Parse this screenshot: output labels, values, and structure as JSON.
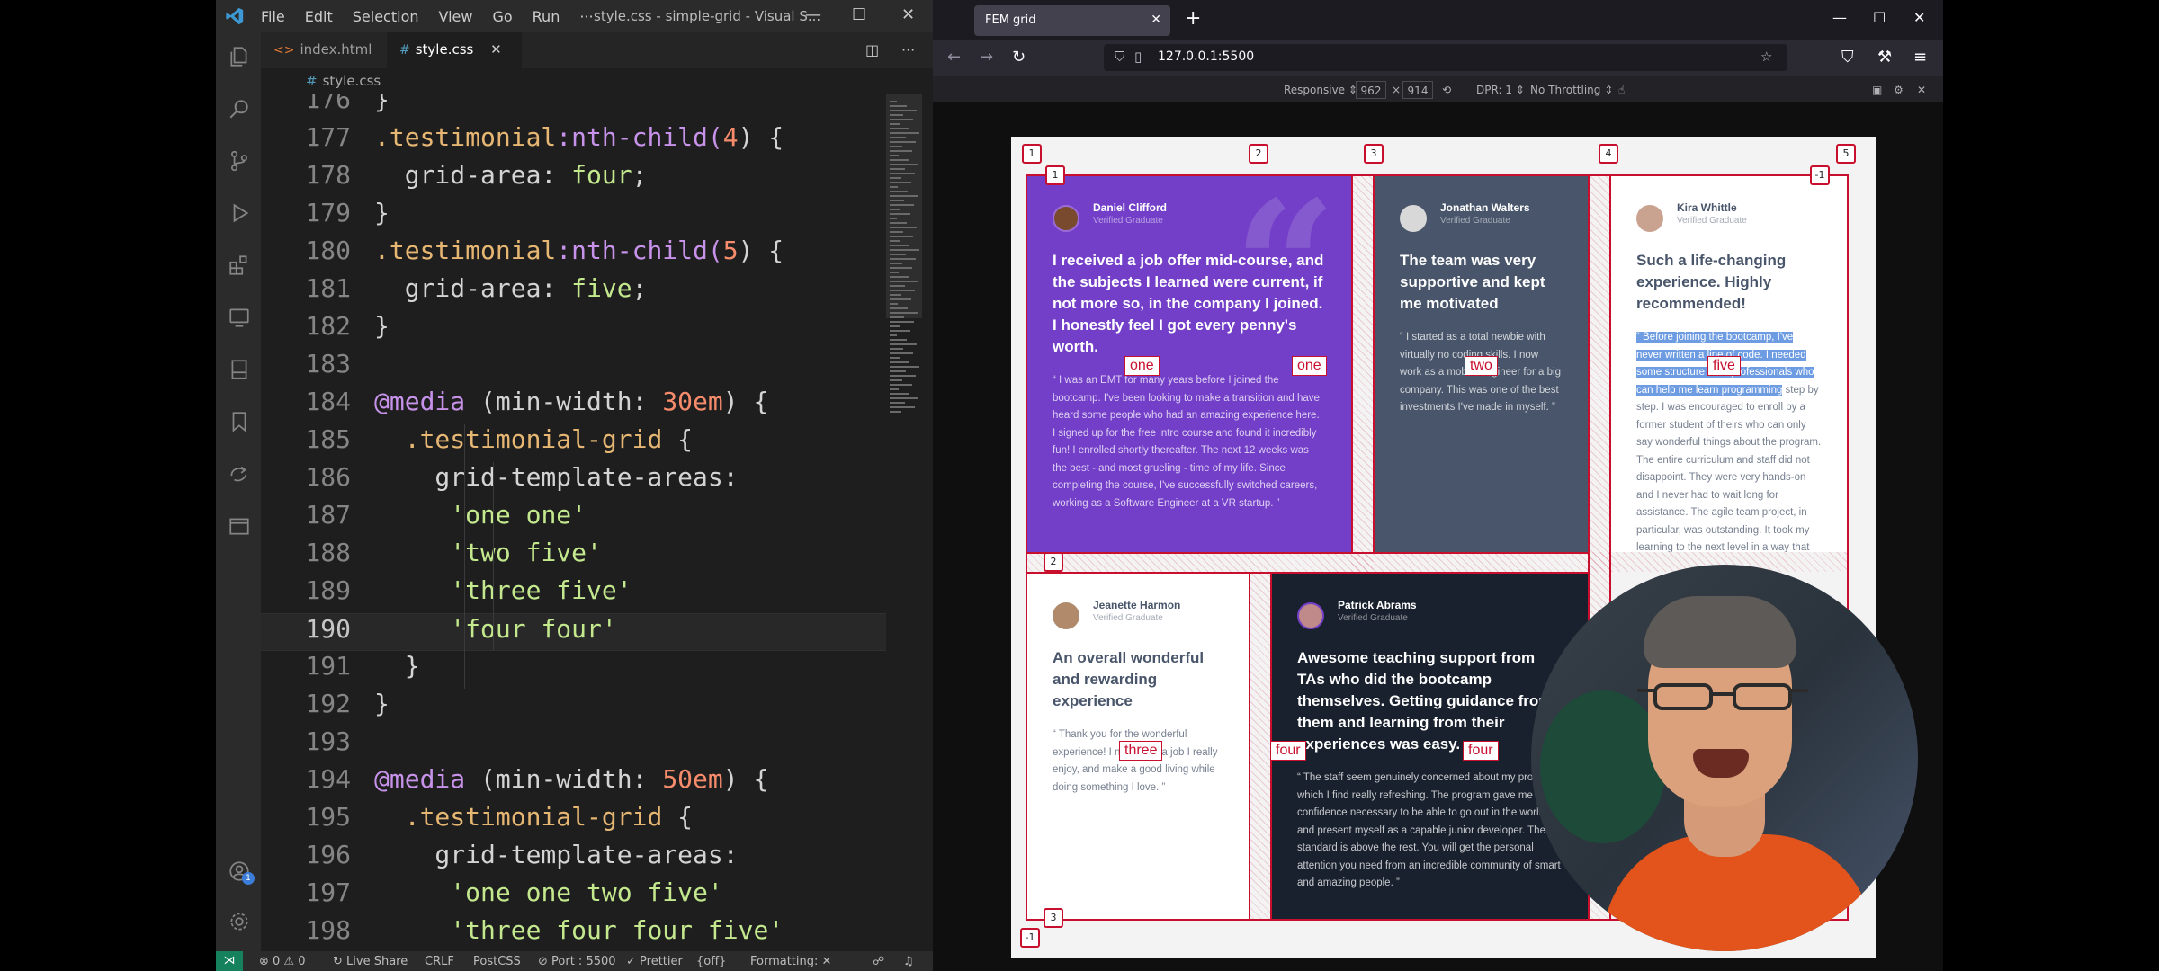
{
  "vscode": {
    "menu": [
      "File",
      "Edit",
      "Selection",
      "View",
      "Go",
      "Run",
      "···"
    ],
    "window_title": "style.css - simple-grid - Visual S...",
    "tabs": [
      {
        "label": "index.html",
        "icon": "html-file-icon"
      },
      {
        "label": "style.css",
        "icon": "css-file-icon"
      }
    ],
    "breadcrumb": "style.css",
    "current_line": 190,
    "lines": [
      {
        "n": "176",
        "tokens": [
          [
            "}",
            "pun"
          ]
        ]
      },
      {
        "n": "177",
        "tokens": [
          [
            ".testimonial",
            "sel"
          ],
          [
            ":nth-child(",
            "pseudo"
          ],
          [
            "4",
            "num"
          ],
          [
            ") {",
            "pun"
          ]
        ]
      },
      {
        "n": "178",
        "tokens": [
          [
            "  grid-area: ",
            "prop"
          ],
          [
            "four",
            "val"
          ],
          [
            ";",
            "pun"
          ]
        ]
      },
      {
        "n": "179",
        "tokens": [
          [
            "}",
            "pun"
          ]
        ]
      },
      {
        "n": "180",
        "tokens": [
          [
            ".testimonial",
            "sel"
          ],
          [
            ":nth-child(",
            "pseudo"
          ],
          [
            "5",
            "num"
          ],
          [
            ") {",
            "pun"
          ]
        ]
      },
      {
        "n": "181",
        "tokens": [
          [
            "  grid-area: ",
            "prop"
          ],
          [
            "five",
            "val"
          ],
          [
            ";",
            "pun"
          ]
        ]
      },
      {
        "n": "182",
        "tokens": [
          [
            "}",
            "pun"
          ]
        ]
      },
      {
        "n": "183",
        "tokens": []
      },
      {
        "n": "184",
        "tokens": [
          [
            "@media",
            "at"
          ],
          [
            " (min-width: ",
            "pun"
          ],
          [
            "30em",
            "num"
          ],
          [
            ") {",
            "pun"
          ]
        ]
      },
      {
        "n": "185",
        "tokens": [
          [
            "  ",
            "pun"
          ],
          [
            ".testimonial-grid",
            "sel"
          ],
          [
            " {",
            "pun"
          ]
        ]
      },
      {
        "n": "186",
        "tokens": [
          [
            "    grid-template-areas:",
            "prop"
          ]
        ]
      },
      {
        "n": "187",
        "tokens": [
          [
            "     ",
            "pun"
          ],
          [
            "'one one'",
            "str"
          ]
        ]
      },
      {
        "n": "188",
        "tokens": [
          [
            "     ",
            "pun"
          ],
          [
            "'two five'",
            "str"
          ]
        ]
      },
      {
        "n": "189",
        "tokens": [
          [
            "     ",
            "pun"
          ],
          [
            "'three five'",
            "str"
          ]
        ]
      },
      {
        "n": "190",
        "tokens": [
          [
            "     ",
            "pun"
          ],
          [
            "'four four'",
            "str"
          ]
        ]
      },
      {
        "n": "191",
        "tokens": [
          [
            "  }",
            "pun"
          ]
        ]
      },
      {
        "n": "192",
        "tokens": [
          [
            "}",
            "pun"
          ]
        ]
      },
      {
        "n": "193",
        "tokens": []
      },
      {
        "n": "194",
        "tokens": [
          [
            "@media",
            "at"
          ],
          [
            " (min-width: ",
            "pun"
          ],
          [
            "50em",
            "num"
          ],
          [
            ") {",
            "pun"
          ]
        ]
      },
      {
        "n": "195",
        "tokens": [
          [
            "  ",
            "pun"
          ],
          [
            ".testimonial-grid",
            "sel"
          ],
          [
            " {",
            "pun"
          ]
        ]
      },
      {
        "n": "196",
        "tokens": [
          [
            "    grid-template-areas:",
            "prop"
          ]
        ]
      },
      {
        "n": "197",
        "tokens": [
          [
            "     ",
            "pun"
          ],
          [
            "'one one two five'",
            "str"
          ]
        ]
      },
      {
        "n": "198",
        "tokens": [
          [
            "     ",
            "pun"
          ],
          [
            "'three four four five'",
            "str"
          ]
        ]
      }
    ],
    "status": {
      "problems": "⊗ 0 ⚠ 0",
      "live_share": "Live Share",
      "eol": "CRLF",
      "language": "PostCSS",
      "port": "Port : 5500",
      "prettier": "Prettier",
      "off": "{off}",
      "formatting": "Formatting: ✕",
      "badge": "1"
    }
  },
  "browser": {
    "tab_title": "FEM grid",
    "url": "127.0.0.1:5500",
    "rdm": {
      "device": "Responsive ⇕",
      "width": "962",
      "x": "×",
      "height": "914",
      "dpr": "DPR: 1 ⇕",
      "throttle": "No Throttling ⇕"
    }
  },
  "page": {
    "cards": [
      {
        "name": "Daniel Clifford",
        "role": "Verified Graduate",
        "heading": "I received a job offer mid-course, and the subjects I learned were current, if not more so, in the company I joined. I honestly feel I got every penny's worth.",
        "body": "“ I was an EMT for many years before I joined the bootcamp. I've been looking to make a transition and have heard some people who had an amazing experience here. I signed up for the free intro course and found it incredibly fun! I enrolled shortly thereafter. The next 12 weeks was the best - and most grueling - time of my life. Since completing the course, I've successfully switched careers, working as a Software Engineer at a VR startup. ”"
      },
      {
        "name": "Jonathan Walters",
        "role": "Verified Graduate",
        "heading": "The team was very supportive and kept me motivated",
        "body": "“ I started as a total newbie with virtually no coding skills. I now work as a mobile engineer for a big company. This was one of the best investments I've made in myself. ”"
      },
      {
        "name": "Kira Whittle",
        "role": "Verified Graduate",
        "heading": "Such a life-changing experience. Highly recommended!",
        "body_selected": "“ Before joining the bootcamp, I've never written a line of code. I needed some structure from professionals who can help me learn programming",
        "body": " step by step. I was encouraged to enroll by a former student of theirs who can only say wonderful things about the program. The entire curriculum and staff did not disappoint. They were very hands-on and I never had to wait long for assistance. The agile team project, in particular, was outstanding. It took my learning to the next level in a way that no tutorial could ever have. In fact, I've often referred to it during interviews as an example of my development experience."
      },
      {
        "name": "Jeanette Harmon",
        "role": "Verified Graduate",
        "heading": "An overall wonderful and rewarding experience",
        "body": "“ Thank you for the wonderful experience! I now have a job I really enjoy, and make a good living while doing something I love. ”"
      },
      {
        "name": "Patrick Abrams",
        "role": "Verified Graduate",
        "heading": "Awesome teaching support from TAs who did the bootcamp themselves. Getting guidance from them and learning from their experiences was easy.",
        "body": "“ The staff seem genuinely concerned about my progress which I find really refreshing. The program gave me the confidence necessary to be able to go out in the world and present myself as a capable junior developer. The standard is above the rest. You will get the personal attention you need from an incredible community of smart and amazing people. ”"
      }
    ],
    "areas": {
      "one": "one",
      "two": "two",
      "three": "three",
      "four": "four",
      "five": "five"
    },
    "col_lines": [
      "1",
      "2",
      "3",
      "4",
      "5"
    ],
    "row_lines": [
      "1",
      "2",
      "3"
    ],
    "neg_labels": {
      "col_end": "-1",
      "row_end": "-1"
    }
  },
  "colors": {
    "purple": "#733fc8",
    "slate": "#48556a",
    "dark": "#19212e",
    "grid_overlay": "#c8102e",
    "vscode_bg": "#1e1e1e"
  }
}
